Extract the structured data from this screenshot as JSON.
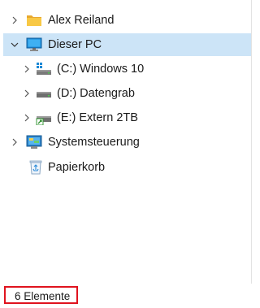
{
  "tree": {
    "items": [
      {
        "label": "Alex Reiland",
        "icon": "folder-icon",
        "expanded": false,
        "selected": false
      },
      {
        "label": "Dieser PC",
        "icon": "computer-icon",
        "expanded": true,
        "selected": true
      },
      {
        "label": "(C:) Windows 10",
        "icon": "windows-drive-icon",
        "expanded": false,
        "selected": false
      },
      {
        "label": "(D:) Datengrab",
        "icon": "drive-icon",
        "expanded": false,
        "selected": false
      },
      {
        "label": "(E:) Extern 2TB",
        "icon": "external-drive-icon",
        "expanded": false,
        "selected": false
      },
      {
        "label": "Systemsteuerung",
        "icon": "control-panel-icon",
        "expanded": false,
        "selected": false
      },
      {
        "label": "Papierkorb",
        "icon": "recycle-bin-icon",
        "expanded": false,
        "selected": false
      }
    ]
  },
  "status_bar": {
    "item_count": "6 Elemente"
  },
  "colors": {
    "selection_background": "#cce4f7",
    "status_highlight": "#e0131e",
    "folder_yellow": "#f8c845",
    "monitor_blue": "#1e8ad6"
  }
}
